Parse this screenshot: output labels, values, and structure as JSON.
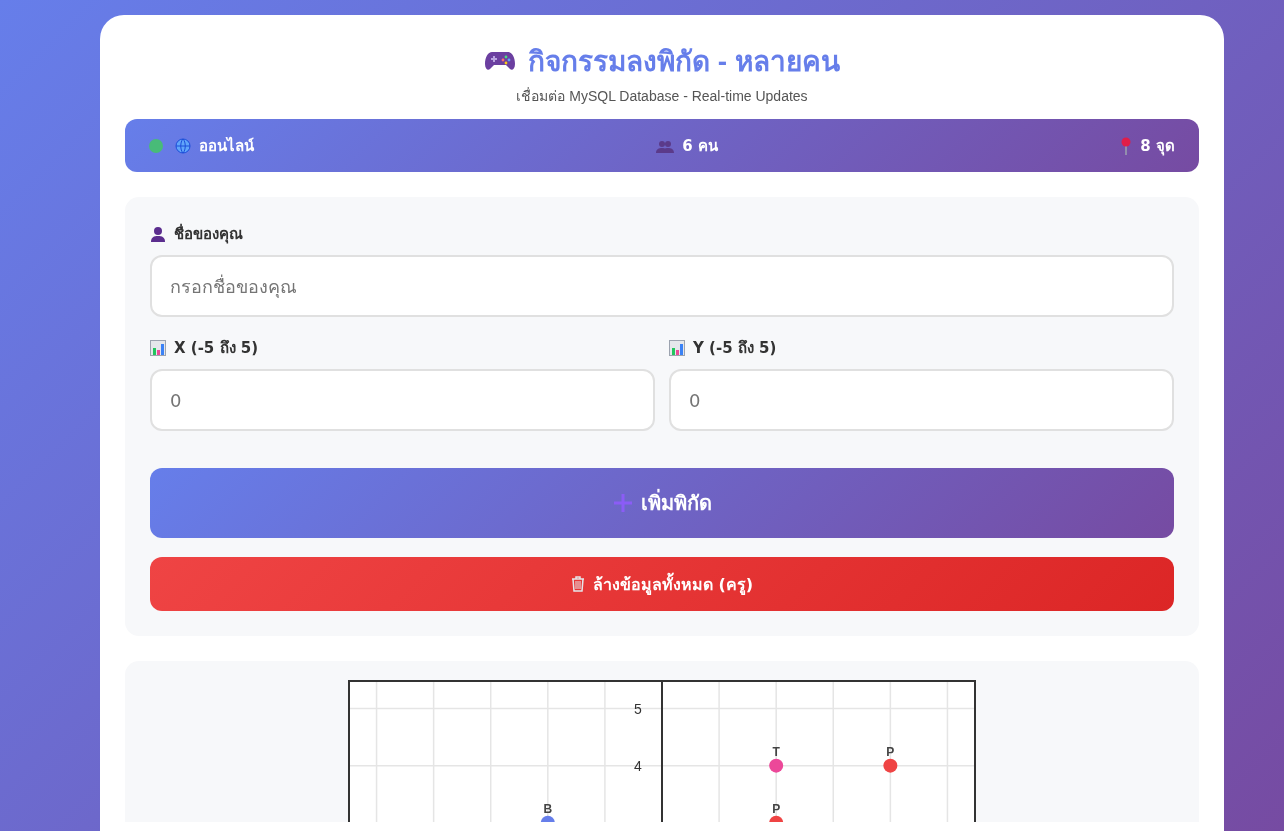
{
  "header": {
    "title": "กิจกรรมลงพิกัด - หลายคน",
    "subtitle": "เชื่อมต่อ MySQL Database - Real-time Updates"
  },
  "status_bar": {
    "online": true,
    "connection": "ออนไลน์",
    "users": "6 คน",
    "points": "8 จุด"
  },
  "form": {
    "name_label": "ชื่อของคุณ",
    "name_placeholder": "กรอกชื่อของคุณ",
    "x_label": "X (-5 ถึง 5)",
    "x_placeholder": "0",
    "y_label": "Y (-5 ถึง 5)",
    "y_placeholder": "0",
    "add_button": "เพิ่มพิกัด",
    "clear_button": "ล้างข้อมูลทั้งหมด (ครู)"
  },
  "chart": {
    "chart_data": {
      "type": "scatter",
      "categories": [
        null,
        null,
        null,
        null,
        null,
        null,
        null,
        null,
        null,
        null,
        null
      ],
      "ylim": [
        -5.5,
        5.5
      ],
      "yticks": [
        4,
        5
      ],
      "grid": true,
      "series": [
        {
          "name": "B",
          "color": "#667eea",
          "values": [
            null,
            null,
            null,
            3,
            null,
            null,
            null,
            null,
            null,
            null,
            null
          ]
        },
        {
          "name": "T",
          "color": "#ec4899",
          "values": [
            null,
            null,
            null,
            null,
            null,
            null,
            null,
            4,
            null,
            null,
            null
          ]
        },
        {
          "name": "P",
          "color": "#ef4444",
          "values": [
            null,
            null,
            null,
            null,
            null,
            null,
            null,
            3,
            null,
            4,
            null
          ]
        }
      ]
    }
  }
}
